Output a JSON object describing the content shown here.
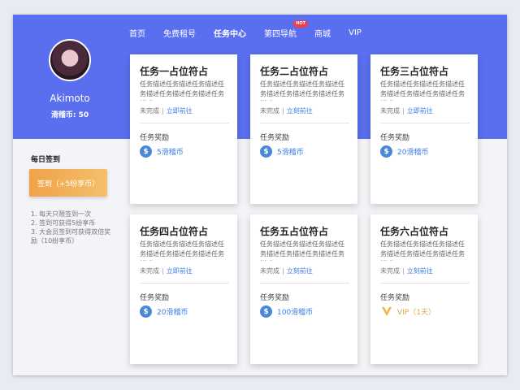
{
  "nav": {
    "items": [
      {
        "label": "首页",
        "active": false
      },
      {
        "label": "免费租号",
        "active": false
      },
      {
        "label": "任务中心",
        "active": true
      },
      {
        "label": "第四导航",
        "active": false,
        "badge": "HOT"
      },
      {
        "label": "商城",
        "active": false
      },
      {
        "label": "VIP",
        "active": false
      }
    ]
  },
  "profile": {
    "username": "Akimoto",
    "coins": "滑稽币: 50"
  },
  "checkin": {
    "title": "每日签到",
    "button_label": "签到（+5纷享币）",
    "rules": [
      "1. 每天只限签到一次",
      "2. 签到可获得5纷享币",
      "3. 大会员签到可获得双倍奖励（10纷享币）"
    ]
  },
  "task_common": {
    "description": "任务描述任务描述任务描述任务描述任务描述任务描述任务描述",
    "status": "未完成",
    "action": "立即前往",
    "reward_label": "任务奖励"
  },
  "tasks": [
    {
      "title": "任务一占位符占",
      "action": "立即前往",
      "reward": "5滑稽币",
      "reward_icon": "coin-icon"
    },
    {
      "title": "任务二占位符占",
      "action": "立刻前往",
      "reward": "5滑稽币",
      "reward_icon": "coin-icon"
    },
    {
      "title": "任务三占位符占",
      "action": "立即前往",
      "reward": "20滑稽币",
      "reward_icon": "coin-icon"
    },
    {
      "title": "任务四占位符占",
      "action": "立即前往",
      "reward": "20滑稽币",
      "reward_icon": "coin-icon"
    },
    {
      "title": "任务五占位符占",
      "action": "立刻前往",
      "reward": "100滑稽币",
      "reward_icon": "coin-icon"
    },
    {
      "title": "任务六占位符占",
      "action": "立刻前往",
      "reward": "VIP（1天）",
      "reward_icon": "vip-icon"
    }
  ],
  "colors": {
    "hero": "#5a6ff0",
    "accent": "#3b7de6",
    "checkin_button": "#f0a24a",
    "vip": "#e5a43b"
  }
}
